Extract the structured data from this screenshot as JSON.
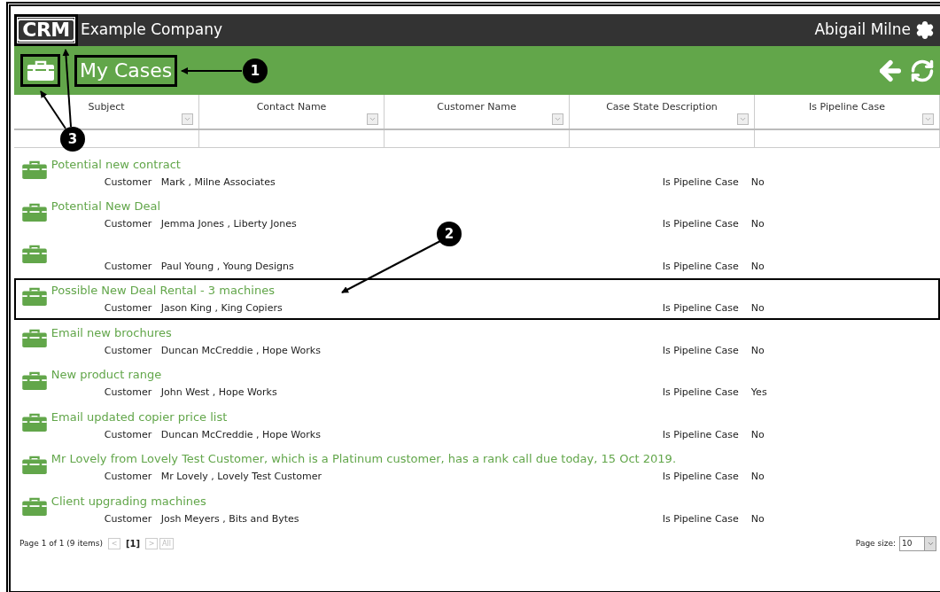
{
  "header": {
    "logo": "CRM",
    "logo_highlighted": true,
    "company": "Example Company",
    "user": "Abigail Milne"
  },
  "title_bar": {
    "title": "My Cases",
    "title_highlighted": true,
    "icon_highlighted": true
  },
  "columns": [
    {
      "label": "Subject"
    },
    {
      "label": "Contact Name"
    },
    {
      "label": "Customer Name"
    },
    {
      "label": "Case State Description"
    },
    {
      "label": "Is Pipeline Case"
    }
  ],
  "rows": [
    {
      "subject": "Potential new contract",
      "customer_label": "Customer",
      "customer": "Mark , Milne Associates",
      "pipeline_label": "Is Pipeline Case",
      "pipeline": "No",
      "highlighted": false
    },
    {
      "subject": "Potential New Deal",
      "customer_label": "Customer",
      "customer": "Jemma Jones , Liberty Jones",
      "pipeline_label": "Is Pipeline Case",
      "pipeline": "No",
      "highlighted": false
    },
    {
      "customer_label": "Customer",
      "customer": "Paul Young , Young Designs",
      "pipeline_label": "Is Pipeline Case",
      "pipeline": "No",
      "highlighted": false
    },
    {
      "subject": "Possible New Deal Rental - 3 machines",
      "customer_label": "Customer",
      "customer": "Jason King , King Copiers",
      "pipeline_label": "Is Pipeline Case",
      "pipeline": "No",
      "highlighted": true
    },
    {
      "subject": "Email new brochures",
      "customer_label": "Customer",
      "customer": "Duncan McCreddie , Hope Works",
      "pipeline_label": "Is Pipeline Case",
      "pipeline": "No",
      "highlighted": false
    },
    {
      "subject": "New product range",
      "customer_label": "Customer",
      "customer": "John West , Hope Works",
      "pipeline_label": "Is Pipeline Case",
      "pipeline": "Yes",
      "highlighted": false
    },
    {
      "subject": "Email updated copier price list",
      "customer_label": "Customer",
      "customer": "Duncan McCreddie , Hope Works",
      "pipeline_label": "Is Pipeline Case",
      "pipeline": "No",
      "highlighted": false
    },
    {
      "subject": "Mr Lovely from Lovely Test Customer, which is a Platinum customer, has a rank call due today, 15 Oct 2019.",
      "customer_label": "Customer",
      "customer": "Mr Lovely , Lovely Test Customer",
      "pipeline_label": "Is Pipeline Case",
      "pipeline": "No",
      "highlighted": false
    },
    {
      "subject": "Client upgrading machines",
      "customer_label": "Customer",
      "customer": "Josh Meyers , Bits and Bytes",
      "pipeline_label": "Is Pipeline Case",
      "pipeline": "No",
      "highlighted": false
    }
  ],
  "pager": {
    "summary": "Page 1 of 1 (9 items)",
    "prev": "<",
    "current": "[1]",
    "next": ">",
    "all": "All"
  },
  "page_size": {
    "label": "Page size:",
    "value": "10"
  },
  "callouts": [
    {
      "number": "1"
    },
    {
      "number": "2"
    },
    {
      "number": "3"
    }
  ]
}
